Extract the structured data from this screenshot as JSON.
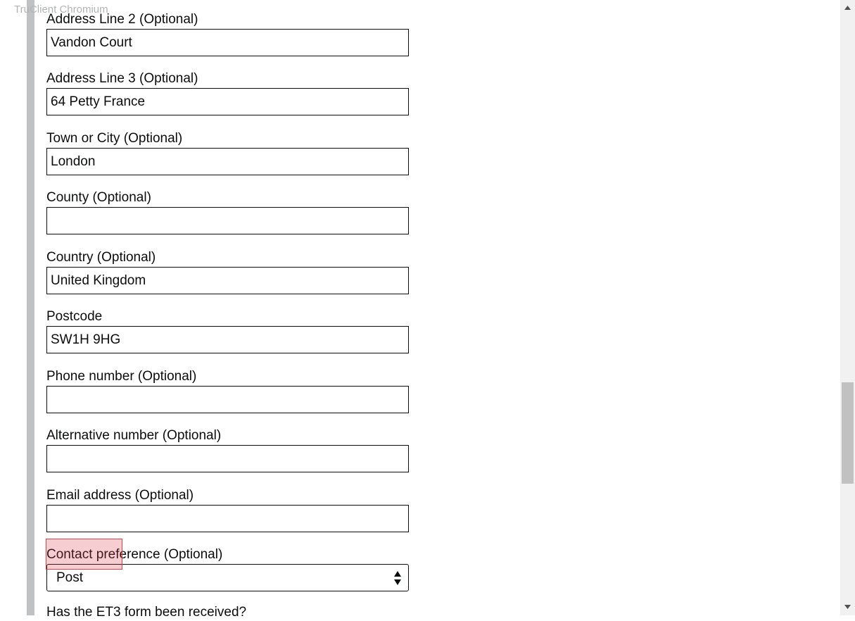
{
  "watermark": "TruClient Chromium",
  "fields": {
    "address2": {
      "label": "Address Line 2 (Optional)",
      "value": "Vandon Court"
    },
    "address3": {
      "label": "Address Line 3 (Optional)",
      "value": "64 Petty France"
    },
    "town": {
      "label": "Town or City (Optional)",
      "value": "London"
    },
    "county": {
      "label": "County (Optional)",
      "value": ""
    },
    "country": {
      "label": "Country (Optional)",
      "value": "United Kingdom"
    },
    "postcode": {
      "label": "Postcode",
      "value": "SW1H 9HG"
    },
    "phone": {
      "label": "Phone number (Optional)",
      "value": ""
    },
    "alt_phone": {
      "label": "Alternative number (Optional)",
      "value": ""
    },
    "email": {
      "label": "Email address (Optional)",
      "value": ""
    },
    "contact_pref": {
      "label": "Contact preference (Optional)",
      "value": "Post"
    }
  },
  "next_question": "Has the ET3 form been received?",
  "icons": {
    "select_arrows": "updown-arrows-icon",
    "scroll_up": "scroll-up-arrow-icon",
    "scroll_down": "scroll-down-arrow-icon"
  },
  "colors": {
    "text": "#0b0c0c",
    "border": "#0b0c0c",
    "left_bar": "#bfc1c3",
    "highlight": "#e0404a",
    "scroll_track": "#f1f1f1",
    "scroll_thumb": "#c1c1c1"
  }
}
